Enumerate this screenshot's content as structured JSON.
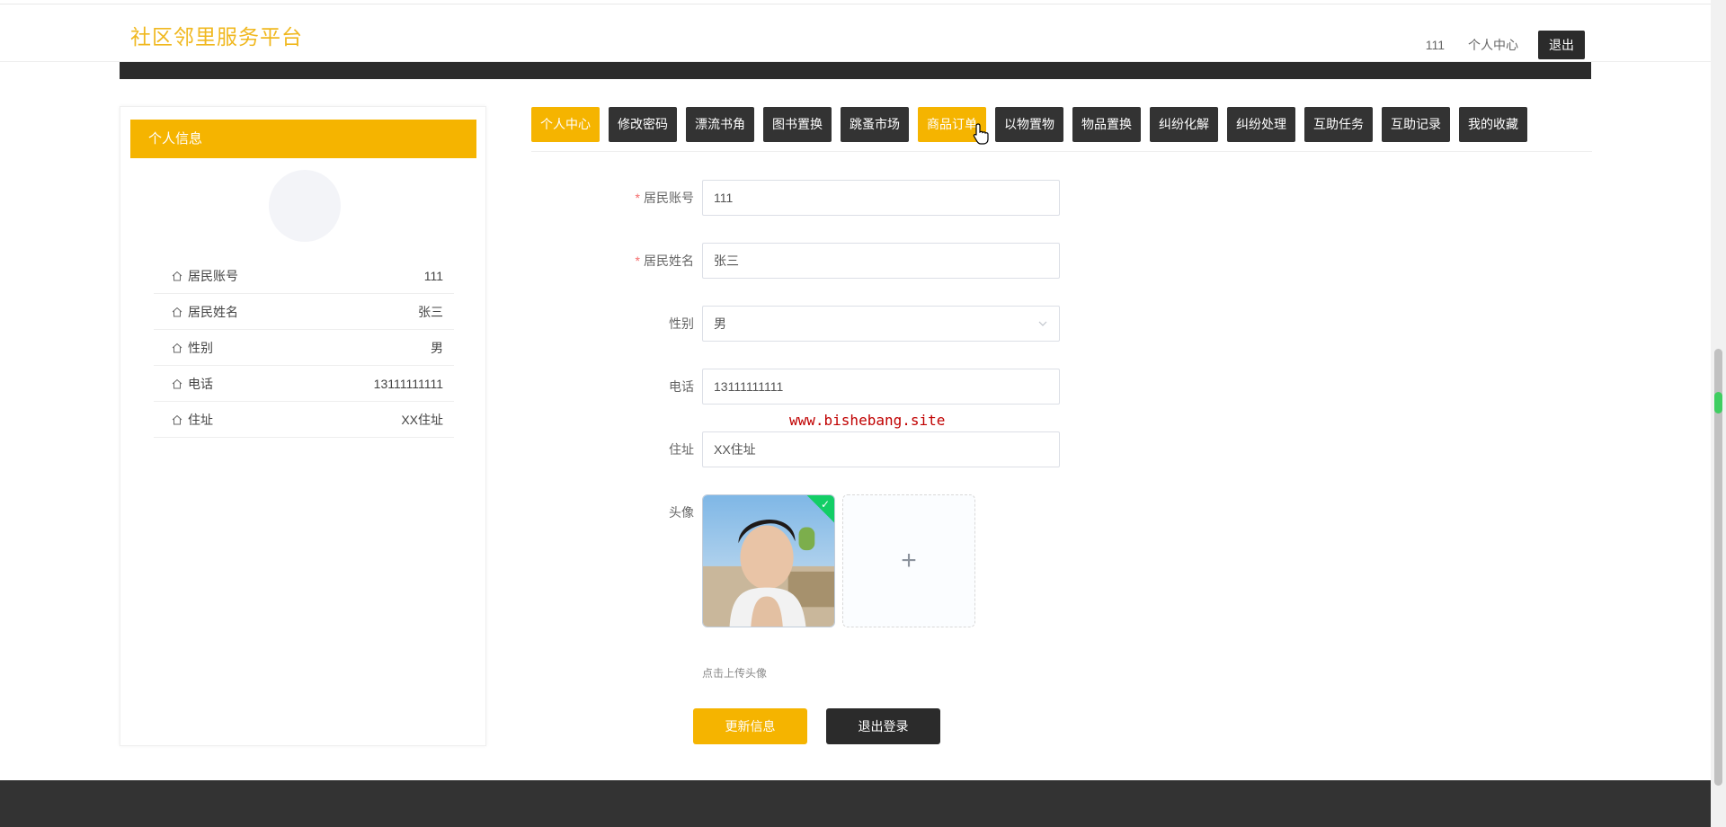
{
  "header": {
    "brand": "社区邻里服务平台",
    "user": "111",
    "center_link": "个人中心",
    "logout_label": "退出"
  },
  "profile": {
    "title": "个人信息",
    "rows": [
      {
        "label": "居民账号",
        "value": "111"
      },
      {
        "label": "居民姓名",
        "value": "张三"
      },
      {
        "label": "性别",
        "value": "男"
      },
      {
        "label": "电话",
        "value": "13111111111"
      },
      {
        "label": "住址",
        "value": "XX住址"
      }
    ]
  },
  "tabs": [
    {
      "label": "个人中心",
      "state": "active"
    },
    {
      "label": "修改密码"
    },
    {
      "label": "漂流书角"
    },
    {
      "label": "图书置换"
    },
    {
      "label": "跳蚤市场"
    },
    {
      "label": "商品订单",
      "state": "hover"
    },
    {
      "label": "以物置物"
    },
    {
      "label": "物品置换"
    },
    {
      "label": "纠纷化解"
    },
    {
      "label": "纠纷处理"
    },
    {
      "label": "互助任务"
    },
    {
      "label": "互助记录"
    },
    {
      "label": "我的收藏"
    }
  ],
  "form": {
    "account": {
      "label": "居民账号",
      "value": "111",
      "required": true
    },
    "name": {
      "label": "居民姓名",
      "value": "张三",
      "required": true
    },
    "gender": {
      "label": "性别",
      "value": "男"
    },
    "phone": {
      "label": "电话",
      "value": "13111111111"
    },
    "address": {
      "label": "住址",
      "value": "XX住址"
    },
    "avatar": {
      "label": "头像",
      "tip": "点击上传头像"
    },
    "required_mark": "*"
  },
  "watermark": "www.bishebang.site",
  "buttons": {
    "update": "更新信息",
    "logout": "退出登录"
  },
  "colors": {
    "accent": "#f5b400",
    "dark": "#2b2b2b",
    "success": "#13ce66"
  }
}
